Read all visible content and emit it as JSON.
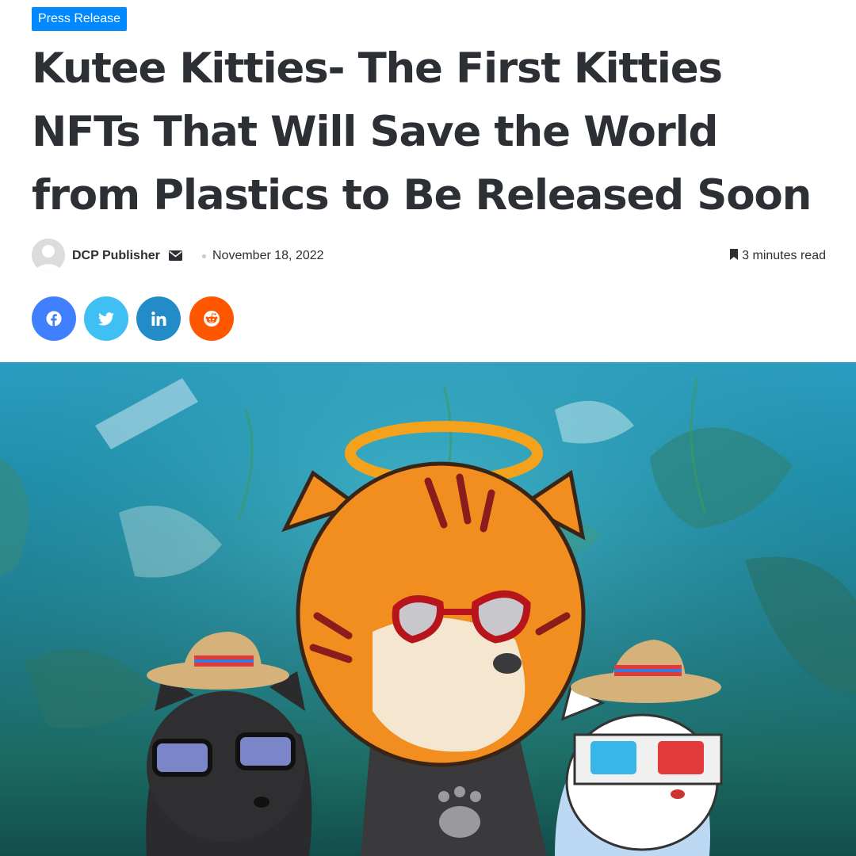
{
  "category": "Press Release",
  "article": {
    "title": "Kutee Kitties- The First Kitties NFTs That Will Save the World from Plastics to Be Released Soon"
  },
  "meta": {
    "author": "DCP Publisher",
    "date": "November 18, 2022",
    "read_time": "3 minutes read"
  },
  "share": [
    {
      "network": "facebook",
      "icon": "facebook-icon",
      "color": "#4080ff"
    },
    {
      "network": "twitter",
      "icon": "twitter-icon",
      "color": "#40bff5"
    },
    {
      "network": "linkedin",
      "icon": "linkedin-icon",
      "color": "#238cc8"
    },
    {
      "network": "reddit",
      "icon": "reddit-icon",
      "color": "#ff5700"
    }
  ],
  "colors": {
    "accent": "#0088ff",
    "text": "#2c2f34"
  }
}
